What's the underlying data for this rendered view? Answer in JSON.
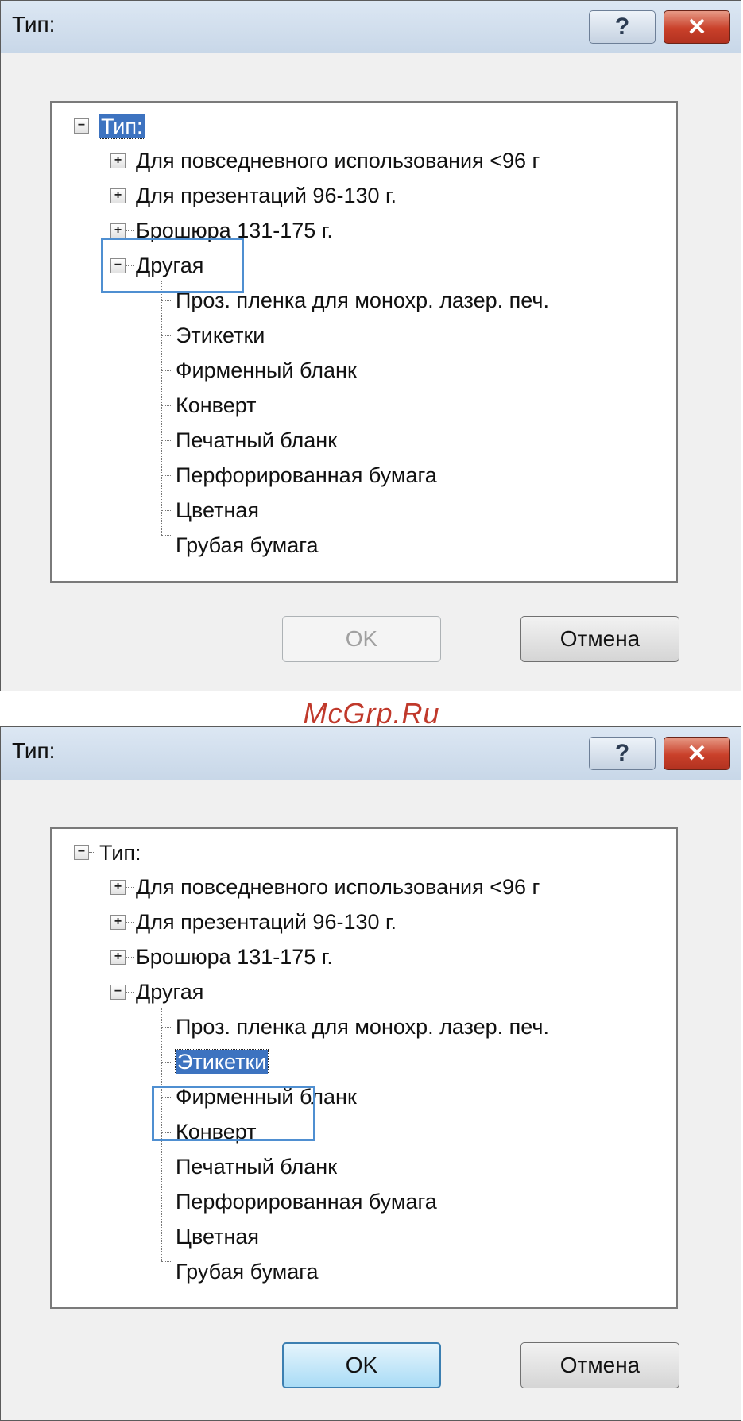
{
  "watermark": "McGrp.Ru",
  "dialogs": [
    {
      "title": "Тип:",
      "help_glyph": "?",
      "close_glyph": "✕",
      "ok_label": "OK",
      "ok_state": "disabled",
      "cancel_label": "Отмена",
      "selected": "root",
      "highlighted": "Другая"
    },
    {
      "title": "Тип:",
      "help_glyph": "?",
      "close_glyph": "✕",
      "ok_label": "OK",
      "ok_state": "enabled",
      "cancel_label": "Отмена",
      "selected": "Этикетки",
      "highlighted": "Этикетки"
    }
  ],
  "tree": {
    "root": "Тип:",
    "groups": [
      {
        "label": "Для повседневного использования <96 г",
        "expanded": false
      },
      {
        "label": "Для презентаций 96-130 г.",
        "expanded": false
      },
      {
        "label": "Брошюра 131-175 г.",
        "expanded": false
      },
      {
        "label": "Другая",
        "expanded": true
      }
    ],
    "children": [
      "Проз. пленка для монохр. лазер. печ.",
      "Этикетки",
      "Фирменный бланк",
      "Конверт",
      "Печатный бланк",
      "Перфорированная бумага",
      "Цветная",
      "Грубая бумага"
    ]
  }
}
